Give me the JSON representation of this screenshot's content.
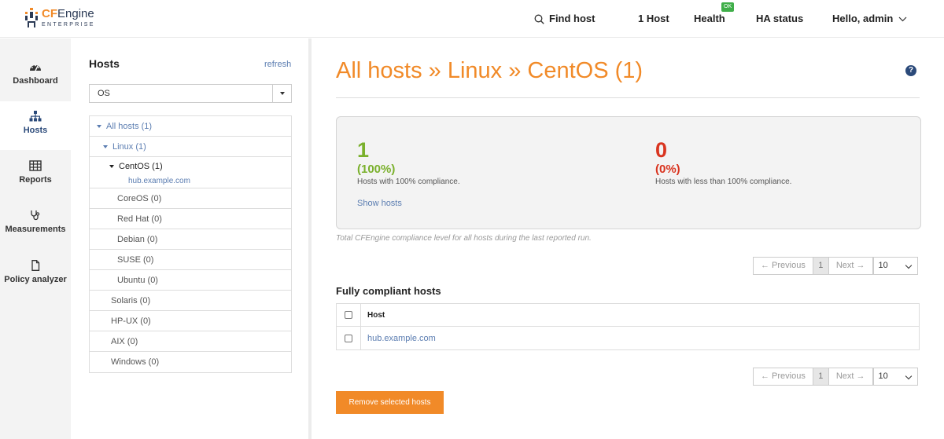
{
  "header": {
    "logo": {
      "brand_cf": "CF",
      "brand_engine": "Engine",
      "sub": "ENTERPRISE"
    },
    "find_host": "Find host",
    "host_count": "1 Host",
    "health": "Health",
    "health_badge": "OK",
    "ha_status": "HA status",
    "user_greeting": "Hello, admin"
  },
  "sidenav": [
    {
      "label": "Dashboard",
      "icon": "dashboard-icon"
    },
    {
      "label": "Hosts",
      "icon": "hosts-icon",
      "active": true
    },
    {
      "label": "Reports",
      "icon": "table-icon"
    },
    {
      "label": "Measurements",
      "icon": "stethoscope-icon"
    },
    {
      "label": "Policy analyzer",
      "icon": "file-icon"
    }
  ],
  "tree_panel": {
    "title": "Hosts",
    "refresh": "refresh",
    "group_by": "OS",
    "items": [
      "All hosts (1)",
      "Linux (1)",
      "CentOS (1)",
      "hub.example.com",
      "CoreOS (0)",
      "Red Hat (0)",
      "Debian (0)",
      "SUSE (0)",
      "Ubuntu (0)",
      "Solaris (0)",
      "HP-UX (0)",
      "AIX (0)",
      "Windows (0)"
    ]
  },
  "main": {
    "title": "All hosts » Linux » CentOS (1)",
    "help": "?",
    "compliance": {
      "compliant_count": "1",
      "compliant_pct": "(100%)",
      "compliant_desc": "Hosts with 100% compliance.",
      "show_hosts": "Show hosts",
      "noncompliant_count": "0",
      "noncompliant_pct": "(0%)",
      "noncompliant_desc": "Hosts with less than 100% compliance."
    },
    "footnote": "Total CFEngine compliance level for all hosts during the last reported run.",
    "pager": {
      "previous": "← Previous",
      "page": "1",
      "next": "Next →",
      "page_size": "10"
    },
    "section_title": "Fully compliant hosts",
    "table": {
      "header": "Host",
      "rows": [
        "hub.example.com"
      ]
    },
    "remove_button": "Remove selected hosts"
  },
  "colors": {
    "accent": "#f18a28",
    "compliant": "#7ab02c",
    "noncompliant": "#d9341f",
    "link": "#5b7db1",
    "ok": "#3fae49"
  }
}
